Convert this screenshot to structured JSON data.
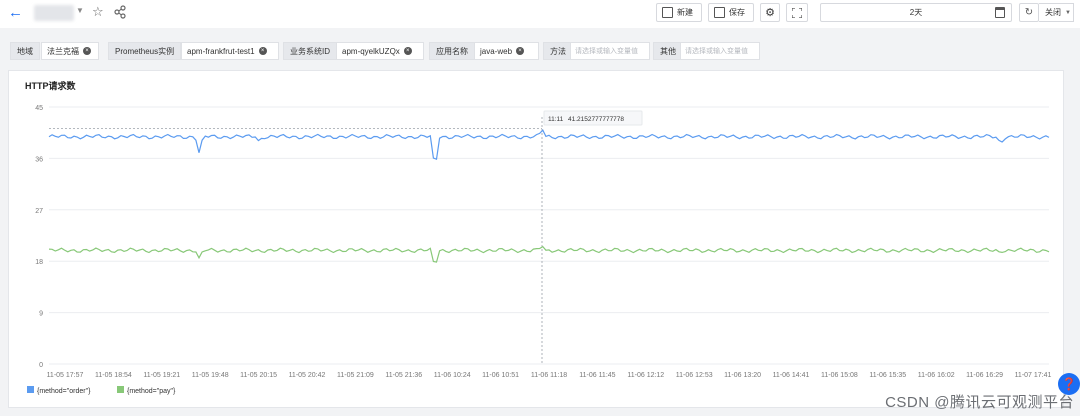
{
  "topbar": {
    "new_label": "新建",
    "save_label": "保存",
    "time_range": "2天",
    "close_label": "关闭"
  },
  "filters": [
    {
      "label": "地域",
      "tag": "法兰克福"
    },
    {
      "label": "Prometheus实例",
      "tag": "apm-frankfrut-test1"
    },
    {
      "label": "业务系统ID",
      "tag": "apm-qyelkUZQx"
    },
    {
      "label": "应用名称",
      "tag": "java-web"
    },
    {
      "label": "方法",
      "placeholder": "请选择或输入变量值"
    },
    {
      "label": "其他",
      "placeholder": "请选择或输入变量值"
    }
  ],
  "panel": {
    "title": "HTTP请求数"
  },
  "watermark": "CSDN @腾讯云可观测平台",
  "chart_data": {
    "type": "line",
    "title": "HTTP请求数",
    "ylim": [
      0,
      45
    ],
    "yticks": [
      "0",
      "9",
      "18",
      "27",
      "36",
      "45"
    ],
    "x_ticks": [
      "11-05 17:57",
      "11-05 18:54",
      "11-05 19:21",
      "11-05 19:48",
      "11-05 20:15",
      "11-05 20:42",
      "11-05 21:09",
      "11-05 21:36",
      "11-06 10:24",
      "11-06 10:51",
      "11-06 11:18",
      "11-06 11:45",
      "11-06 12:12",
      "11-06 12:53",
      "11-06 13:20",
      "11-06 14:41",
      "11-06 15:08",
      "11-06 15:35",
      "11-06 16:02",
      "11-06 16:29",
      "11-07 17:41"
    ],
    "grid": true,
    "legend_position": "bottom-left",
    "tooltip": {
      "time": "11:11",
      "value": "41.2152777777778",
      "series_value": 41.2152777777778
    },
    "series": [
      {
        "name": "{method=\"order\"}",
        "color": "#5b9bf0",
        "baseline": 39.8,
        "spikes": [
          {
            "x": 0.15,
            "y": 37.0
          },
          {
            "x": 0.21,
            "y": 39.0
          },
          {
            "x": 0.386,
            "y": 33.5
          },
          {
            "x": 0.493,
            "y": 41.2
          },
          {
            "x": 0.952,
            "y": 38.5
          }
        ]
      },
      {
        "name": "{method=\"pay\"}",
        "color": "#88c878",
        "baseline": 19.9,
        "spikes": [
          {
            "x": 0.15,
            "y": 18.6
          },
          {
            "x": 0.386,
            "y": 16.6
          },
          {
            "x": 0.493,
            "y": 20.7
          },
          {
            "x": 0.952,
            "y": 19.4
          }
        ]
      }
    ]
  }
}
